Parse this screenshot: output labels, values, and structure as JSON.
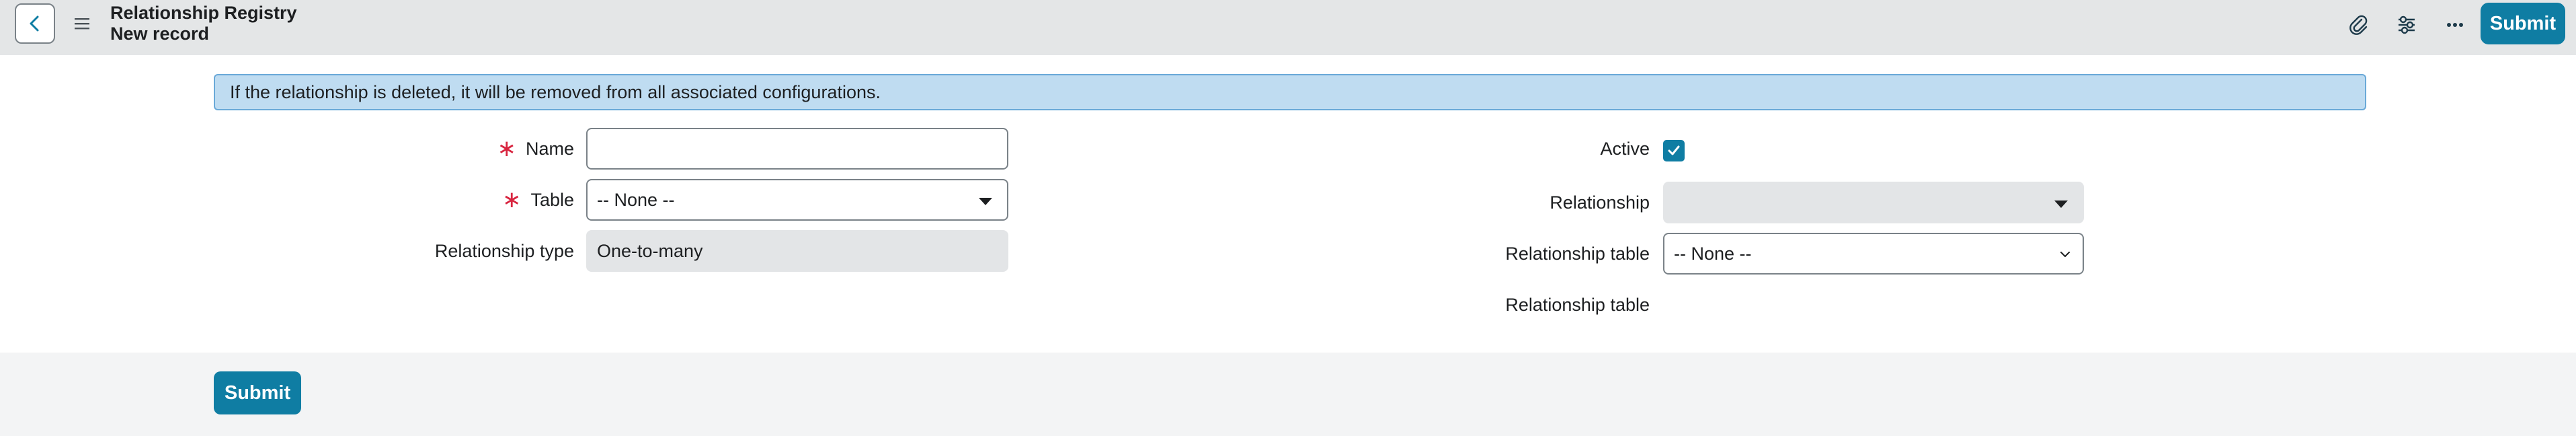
{
  "header": {
    "title_line1": "Relationship Registry",
    "title_line2": "New record",
    "submit_label": "Submit",
    "icons": [
      "back-icon",
      "menu-icon",
      "paperclip-icon",
      "sliders-icon",
      "more-icon"
    ]
  },
  "banner": {
    "text": "If the relationship is deleted, it will be removed from all associated configurations."
  },
  "form": {
    "name": {
      "label": "Name",
      "required_mark": "∗",
      "value": ""
    },
    "table": {
      "label": "Table",
      "required_mark": "∗",
      "value": "-- None --"
    },
    "relationship_type": {
      "label": "Relationship type",
      "value": "One-to-many"
    },
    "active": {
      "label": "Active",
      "checked": true
    },
    "relationship": {
      "label": "Relationship",
      "value": ""
    },
    "relationship_table_select": {
      "label": "Relationship table",
      "value": "-- None --"
    },
    "relationship_table_static": {
      "label": "Relationship table"
    }
  },
  "footer": {
    "submit_label": "Submit"
  },
  "colors": {
    "accent": "#0f7da3",
    "required": "#d8243f",
    "banner_bg": "#bfdcf1",
    "header_bg": "#e4e6e7"
  }
}
